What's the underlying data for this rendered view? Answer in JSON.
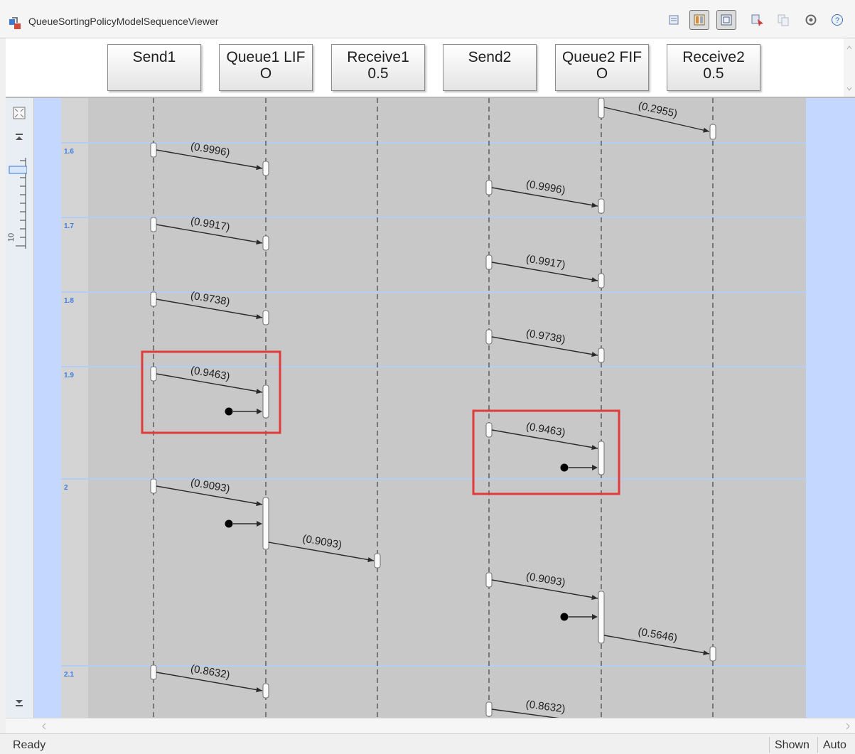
{
  "window": {
    "title": "QueueSortingPolicyModelSequenceViewer"
  },
  "toolbar": {
    "buttons": [
      {
        "name": "properties-icon",
        "pressed": false
      },
      {
        "name": "lifeline-header-icon",
        "pressed": true
      },
      {
        "name": "message-table-icon",
        "pressed": true
      },
      {
        "name": "highlight-message-icon",
        "pressed": false
      },
      {
        "name": "copy-icon",
        "pressed": false
      },
      {
        "name": "settings-icon",
        "pressed": false
      },
      {
        "name": "help-icon",
        "pressed": false
      }
    ]
  },
  "lifelines": [
    {
      "label_line1": "Send1",
      "label_line2": ""
    },
    {
      "label_line1": "Queue1 LIF",
      "label_line2": "O"
    },
    {
      "label_line1": "Receive1",
      "label_line2": "0.5"
    },
    {
      "label_line1": "Send2",
      "label_line2": ""
    },
    {
      "label_line1": "Queue2 FIF",
      "label_line2": "O"
    },
    {
      "label_line1": "Receive2",
      "label_line2": "0.5"
    }
  ],
  "navigator": {
    "zoom_label": "10"
  },
  "time_labels": [
    "1.6",
    "1.7",
    "1.8",
    "1.9",
    "2",
    "2.1"
  ],
  "messages": [
    {
      "from": 4,
      "to": 5,
      "label": "(0.2955)"
    },
    {
      "from": 0,
      "to": 1,
      "label": "(0.9996)"
    },
    {
      "from": 3,
      "to": 4,
      "label": "(0.9996)"
    },
    {
      "from": 0,
      "to": 1,
      "label": "(0.9917)"
    },
    {
      "from": 3,
      "to": 4,
      "label": "(0.9917)"
    },
    {
      "from": 0,
      "to": 1,
      "label": "(0.9738)"
    },
    {
      "from": 3,
      "to": 4,
      "label": "(0.9738)"
    },
    {
      "from": 0,
      "to": 1,
      "label": "(0.9463)"
    },
    {
      "from": 3,
      "to": 4,
      "label": "(0.9463)"
    },
    {
      "from": 0,
      "to": 1,
      "label": "(0.9093)"
    },
    {
      "from": 1,
      "to": 2,
      "label": "(0.9093)"
    },
    {
      "from": 3,
      "to": 4,
      "label": "(0.9093)"
    },
    {
      "from": 4,
      "to": 5,
      "label": "(0.5646)"
    },
    {
      "from": 0,
      "to": 1,
      "label": "(0.8632)"
    },
    {
      "from": 3,
      "to": 4,
      "label": "(0.8632)"
    }
  ],
  "highlight_color": "#e03a3a",
  "status": {
    "state": "Ready",
    "shown": "Shown",
    "auto": "Auto"
  }
}
